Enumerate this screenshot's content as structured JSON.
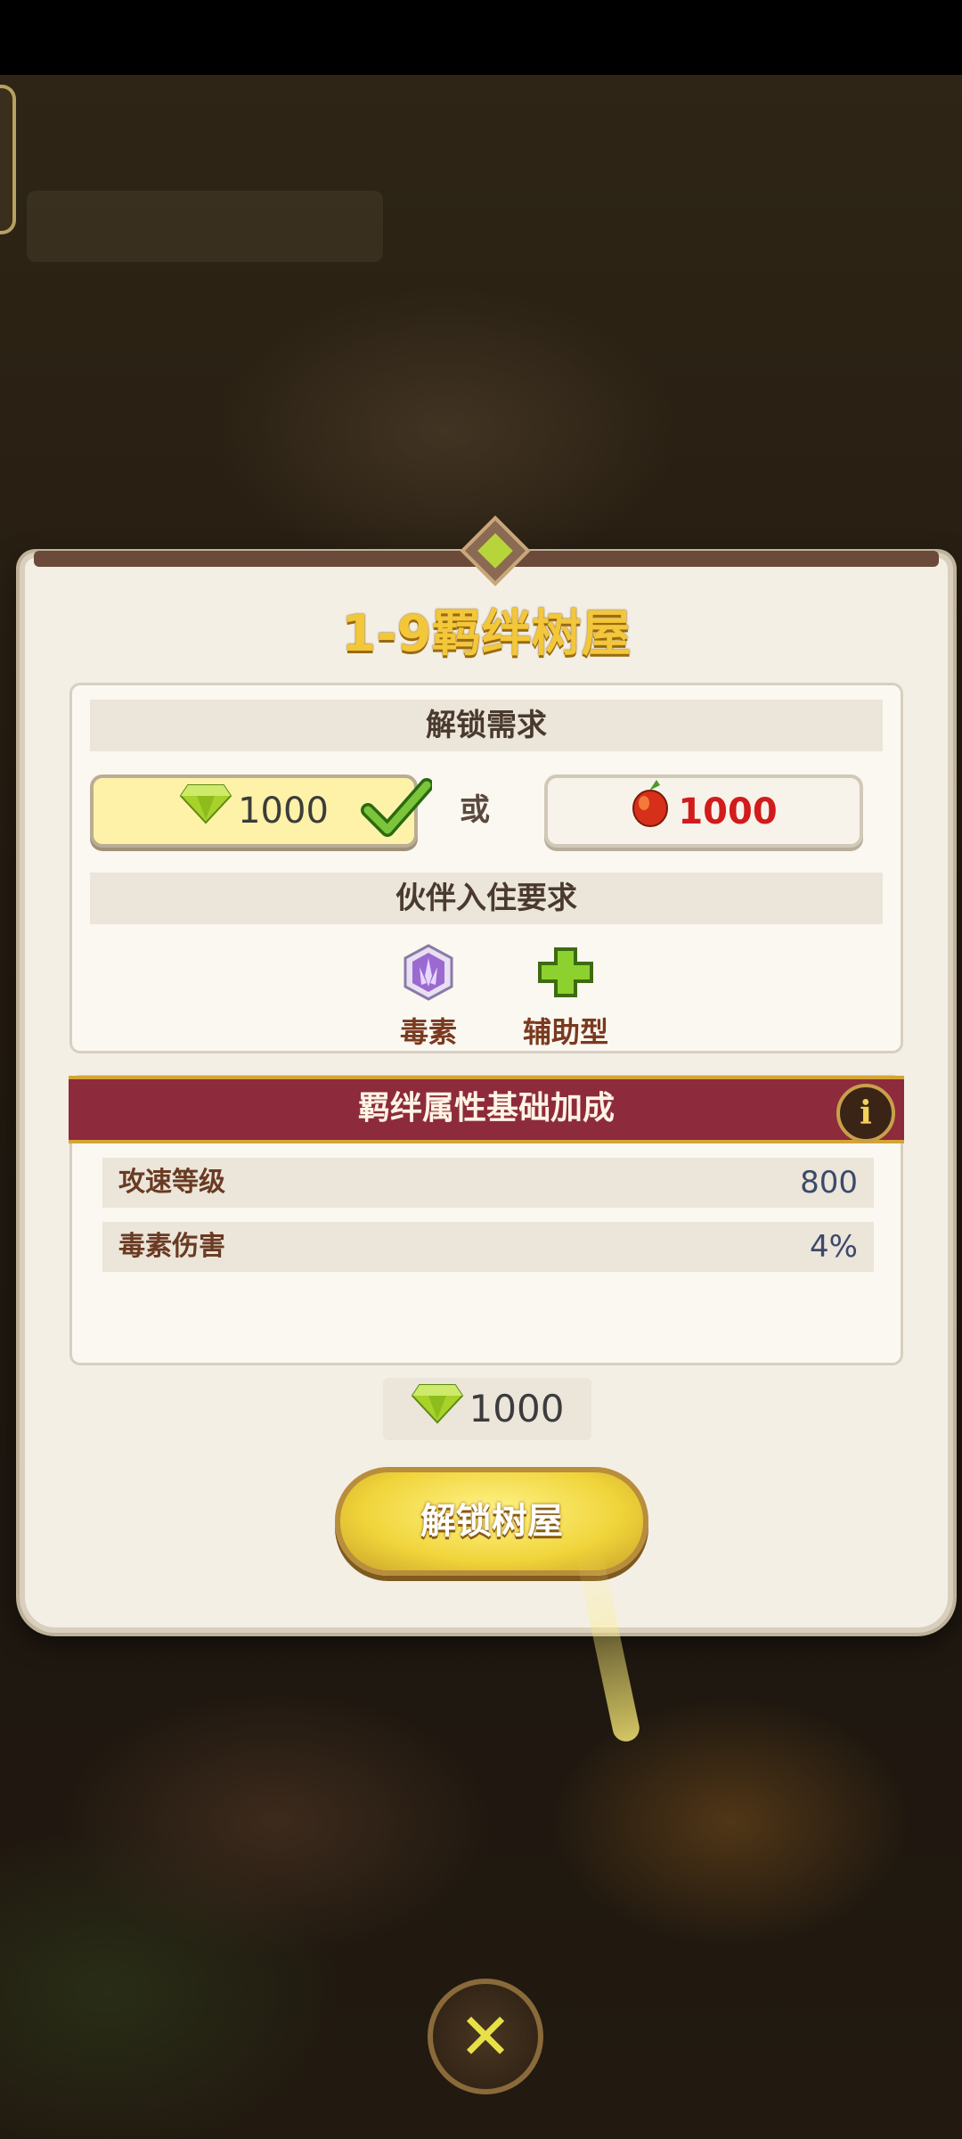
{
  "panel": {
    "title": "1-9羁绊树屋"
  },
  "unlock_requirements": {
    "heading": "解锁需求",
    "gem_cost": "1000",
    "or_text": "或",
    "fruit_cost": "1000"
  },
  "partner_requirements": {
    "heading": "伙伴入住要求",
    "items": [
      {
        "label": "毒素",
        "icon": "poison-element-icon"
      },
      {
        "label": "辅助型",
        "icon": "support-type-icon"
      }
    ]
  },
  "bond_attributes": {
    "heading": "羁绊属性基础加成",
    "info_label": "i",
    "rows": [
      {
        "name": "攻速等级",
        "value": "800"
      },
      {
        "name": "毒素伤害",
        "value": "4%"
      }
    ]
  },
  "unlock_cost": "1000",
  "unlock_button_label": "解锁树屋",
  "colors": {
    "title_gold": "#f3c73a",
    "banner_red": "#8d2b3c",
    "fruit_red": "#d21b1b",
    "gem_green": "#a8d12a"
  }
}
